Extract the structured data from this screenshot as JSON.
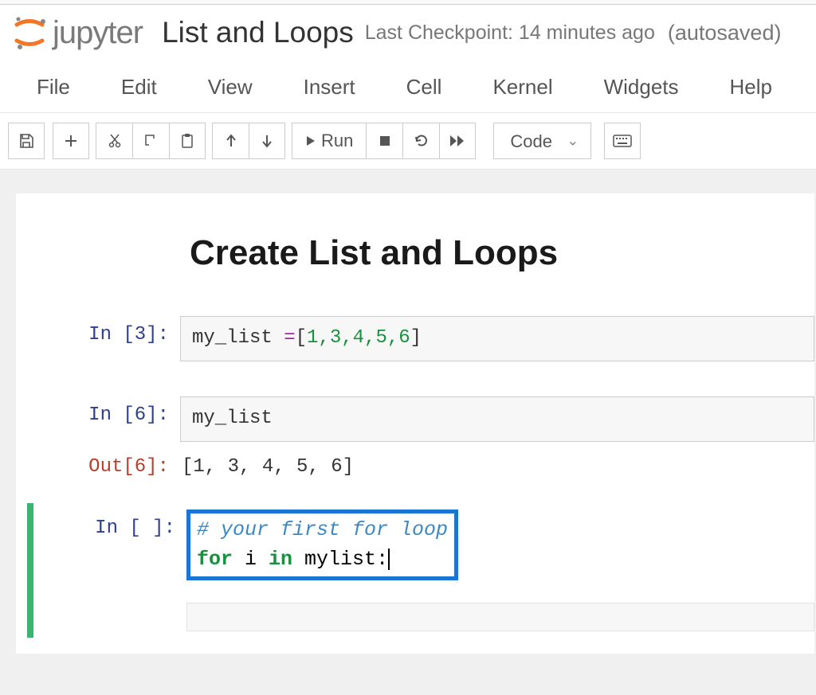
{
  "header": {
    "brand": "jupyter",
    "title": "List and Loops",
    "checkpoint": "Last Checkpoint: 14 minutes ago",
    "autosaved": "(autosaved)"
  },
  "menubar": {
    "items": [
      "File",
      "Edit",
      "View",
      "Insert",
      "Cell",
      "Kernel",
      "Widgets",
      "Help"
    ]
  },
  "toolbar": {
    "run_label": "Run",
    "cell_type": "Code"
  },
  "notebook": {
    "heading": "Create List and Loops",
    "cells": [
      {
        "in_prompt": "In [3]:",
        "code_prefix": "my_list ",
        "code_op": "=",
        "code_bracket_open": "[",
        "code_values": "1,3,4,5,6",
        "code_bracket_close": "]"
      },
      {
        "in_prompt": "In [6]:",
        "code": "my_list",
        "out_prompt": "Out[6]:",
        "output": "[1, 3, 4, 5, 6]"
      },
      {
        "in_prompt": "In [ ]:",
        "comment": "# your first for loop",
        "kw1": "for",
        "var": " i ",
        "kw2": "in",
        "rest": " mylist:"
      }
    ]
  }
}
